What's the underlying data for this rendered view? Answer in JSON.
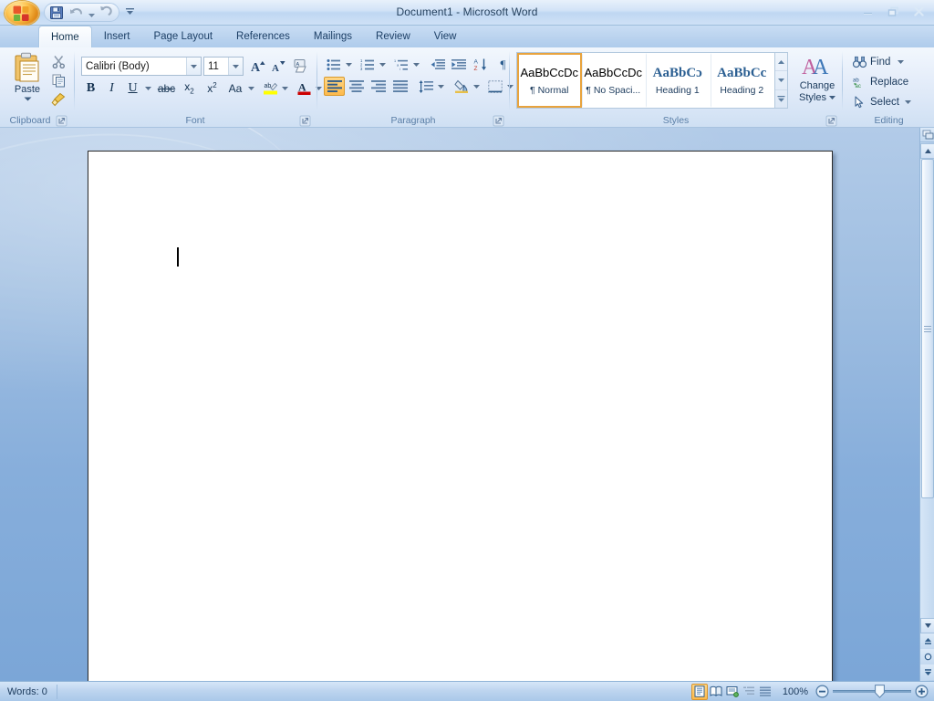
{
  "window": {
    "title": "Document1  -  Microsoft Word",
    "controls": {
      "minimize": "Minimize",
      "restore": "Restore Down",
      "close": "Close"
    }
  },
  "quick_access": {
    "office_button": "Office Button",
    "items": [
      {
        "name": "save",
        "label": "Save"
      },
      {
        "name": "undo",
        "label": "Undo"
      },
      {
        "name": "redo",
        "label": "Redo"
      }
    ],
    "customize": "Customize Quick Access Toolbar"
  },
  "ribbon": {
    "tabs": [
      {
        "label": "Home",
        "active": true
      },
      {
        "label": "Insert",
        "active": false
      },
      {
        "label": "Page Layout",
        "active": false
      },
      {
        "label": "References",
        "active": false
      },
      {
        "label": "Mailings",
        "active": false
      },
      {
        "label": "Review",
        "active": false
      },
      {
        "label": "View",
        "active": false
      }
    ],
    "groups": {
      "clipboard": {
        "label": "Clipboard",
        "paste": "Paste",
        "cut": "Cut",
        "copy": "Copy",
        "format_painter": "Format Painter",
        "launcher": "Clipboard dialog box launcher"
      },
      "font": {
        "label": "Font",
        "font_name": "Calibri (Body)",
        "font_name_placeholder": "Font",
        "font_size": "11",
        "font_size_placeholder": "Font Size",
        "grow_font": "Grow Font",
        "shrink_font": "Shrink Font",
        "clear_formatting": "Clear Formatting",
        "bold": "Bold",
        "italic": "Italic",
        "underline": "Underline",
        "strikethrough": "Strikethrough",
        "subscript": "Subscript",
        "superscript": "Superscript",
        "change_case": "Change Case",
        "highlight": "Text Highlight Color",
        "font_color": "Font Color",
        "launcher": "Font dialog box launcher"
      },
      "paragraph": {
        "label": "Paragraph",
        "bullets": "Bullets",
        "numbering": "Numbering",
        "multilevel": "Multilevel List",
        "decrease_indent": "Decrease Indent",
        "increase_indent": "Increase Indent",
        "sort": "Sort",
        "show_marks": "Show/Hide ¶",
        "align_left": "Align Text Left",
        "align_center": "Center",
        "align_right": "Align Text Right",
        "justify": "Justify",
        "line_spacing": "Line and Paragraph Spacing",
        "shading": "Shading",
        "borders": "Borders",
        "launcher": "Paragraph dialog box launcher"
      },
      "styles": {
        "label": "Styles",
        "items": [
          {
            "preview": "AaBbCcDc",
            "name": "¶ Normal",
            "serif": false,
            "selected": true
          },
          {
            "preview": "AaBbCcDc",
            "name": "¶ No Spaci...",
            "serif": false,
            "selected": false
          },
          {
            "preview": "AaBbCɔ",
            "name": "Heading 1",
            "serif": true,
            "selected": false
          },
          {
            "preview": "AaBbCc",
            "name": "Heading 2",
            "serif": true,
            "selected": false
          }
        ],
        "scroll_up": "Scroll Up",
        "scroll_down": "Scroll Down",
        "more": "More Styles",
        "change_styles_line1": "Change",
        "change_styles_line2": "Styles",
        "launcher": "Styles dialog box launcher"
      },
      "editing": {
        "label": "Editing",
        "find": "Find",
        "replace": "Replace",
        "select": "Select"
      }
    }
  },
  "document": {
    "page_background": "#ffffff",
    "caret_visible": true
  },
  "scrollbar": {
    "split": "Split window",
    "up": "Line Up",
    "down": "Line Down",
    "thumb": "Scroll box",
    "previous": "Previous Page",
    "browse_object": "Select Browse Object",
    "next": "Next Page"
  },
  "status_bar": {
    "words": "Words: 0",
    "views": [
      {
        "name": "print-layout",
        "label": "Print Layout",
        "active": true
      },
      {
        "name": "full-screen-reading",
        "label": "Full Screen Reading",
        "active": false
      },
      {
        "name": "web-layout",
        "label": "Web Layout",
        "active": false
      },
      {
        "name": "outline",
        "label": "Outline",
        "active": false
      },
      {
        "name": "draft",
        "label": "Draft",
        "active": false
      }
    ],
    "zoom_level": "100%",
    "zoom_out": "Zoom Out",
    "zoom_in": "Zoom In",
    "zoom_slider": "Zoom Slider"
  },
  "colors": {
    "accent_orange": "#fcb94c",
    "title_text": "#26425f",
    "group_label": "#5a7ea6",
    "heading_blue": "#2b5f92",
    "highlight_yellow": "#ffff00",
    "font_red": "#cc0000"
  }
}
